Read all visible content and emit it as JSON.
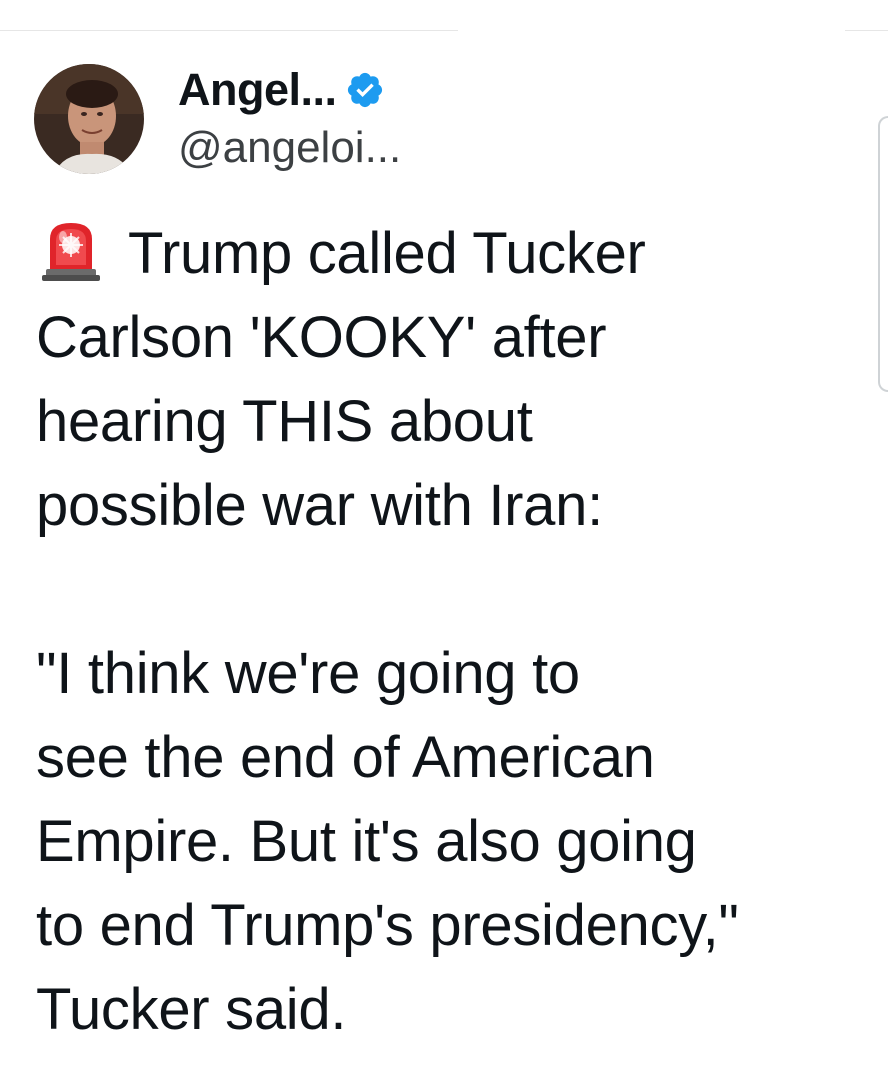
{
  "tweet": {
    "author": {
      "display_name": "Angel...",
      "handle": "@angeloi...",
      "verified": true,
      "verified_color": "#1d9bf0"
    },
    "emoji": "police-car-light",
    "lines": [
      "Trump called Tucker",
      "Carlson 'KOOKY' after",
      "hearing THIS about",
      "possible war with Iran:",
      "",
      "\"I think we're going to",
      "see the end of American",
      "Empire. But it's also going",
      "to end Trump's presidency,\"",
      "Tucker said."
    ]
  }
}
